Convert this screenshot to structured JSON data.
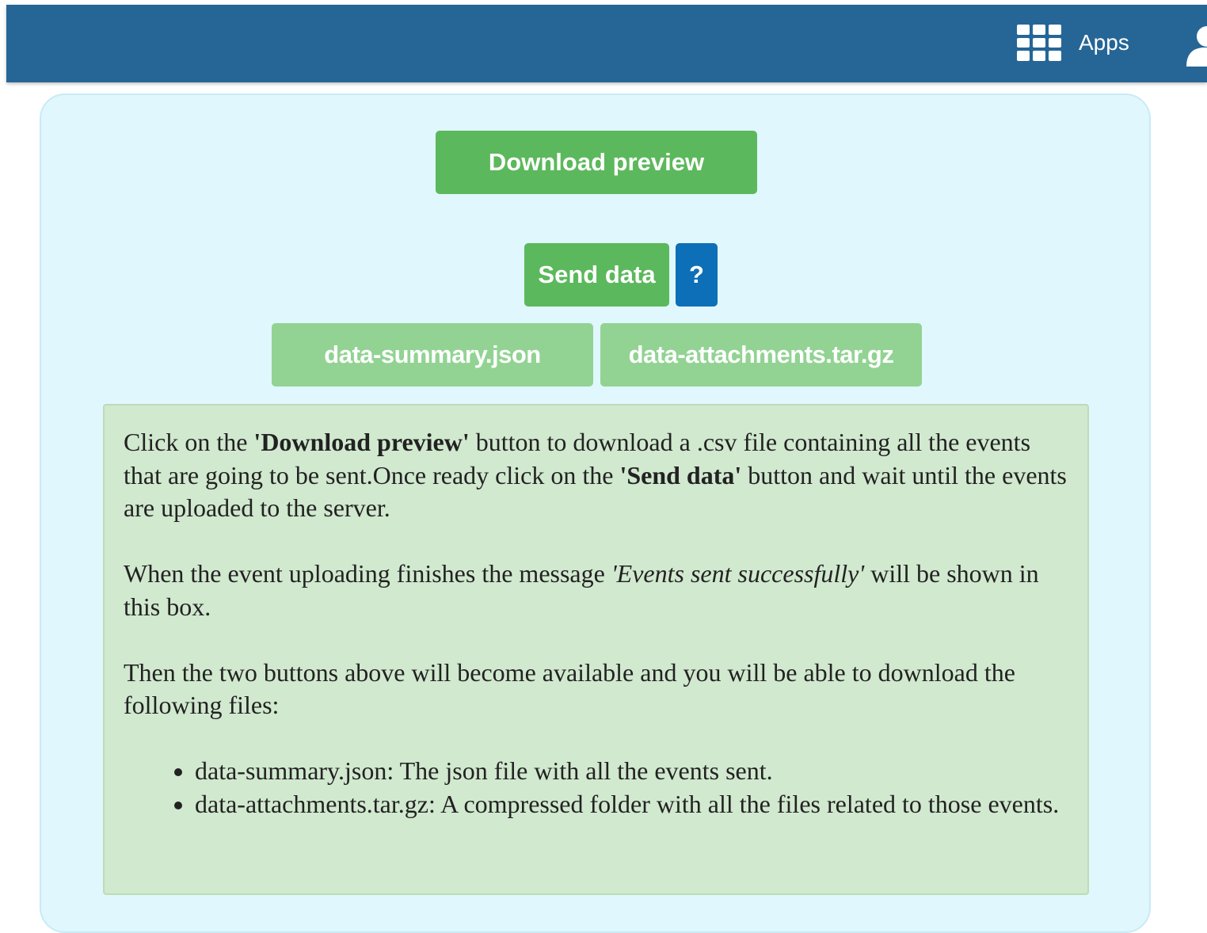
{
  "header": {
    "apps_label": "Apps",
    "icons": [
      "apps-grid-icon",
      "user-icon"
    ],
    "background_color": "#266696"
  },
  "buttons": {
    "download_preview": "Download preview",
    "send_data": "Send data",
    "help": "?",
    "summary_file": "data-summary.json",
    "attachments_file": "data-attachments.tar.gz"
  },
  "colors": {
    "primary_green": "#5cb85c",
    "disabled_green": "#92d393",
    "help_blue": "#0c6fb7",
    "panel_bg": "#e0f7fd",
    "info_bg": "#d1e9cf"
  },
  "info": {
    "p1_before": "Click on the ",
    "p1_bold1": "'Download preview'",
    "p1_middle": " button to download a .csv file containing all the events that are going to be sent.Once ready click on the ",
    "p1_bold2": "'Send data'",
    "p1_after": " button and wait until the events are uploaded to the server.",
    "p2_before": "When the event uploading finishes the message ",
    "p2_italic": "'Events sent successfully'",
    "p2_after": " will be shown in this box.",
    "p3": "Then the two buttons above will become available and you will be able to download the following files:",
    "list": [
      "data-summary.json: The json file with all the events sent.",
      "data-attachments.tar.gz: A compressed folder with all the files related to those events."
    ]
  }
}
